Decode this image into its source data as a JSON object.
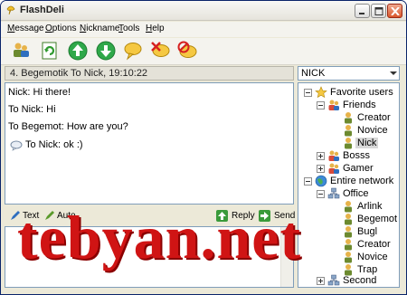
{
  "window": {
    "title": "FlashDeli"
  },
  "menu": [
    "Message",
    "Options",
    "Nickname",
    "Tools",
    "Help"
  ],
  "menu_underline": [
    "M",
    "O",
    "N",
    "T",
    "H"
  ],
  "toolbar_icons": [
    "users-icon",
    "refresh-icon",
    "arrow-up-icon",
    "arrow-down-icon",
    "message-icon",
    "delete-message-icon",
    "ignore-icon"
  ],
  "conversation": {
    "header": "4. Begemotik To  Nick, 19:10:22"
  },
  "nick_select": {
    "value": "NICK"
  },
  "chat": [
    "Nick: Hi there!",
    "To  Nick: Hi",
    "To  Begemot: How are you?",
    "To  Nick:  ok :)"
  ],
  "input_toolbar": {
    "text_label": "Text",
    "auto_label": "Auto",
    "reply_label": "Reply",
    "send_label": "Send"
  },
  "tree": {
    "favorite": "Favorite users",
    "friends": "Friends",
    "friends_children": [
      "Creator",
      "Novice",
      "Nick"
    ],
    "bosss": "Bosss",
    "gamer": "Gamer",
    "network": "Entire network",
    "office": "Office",
    "office_children": [
      "Arlink",
      "Begemot",
      "Bugl",
      "Creator",
      "Novice",
      "Trap"
    ],
    "second": "Second"
  },
  "watermark": "tebyan.net",
  "colors": {
    "watermark": "#d01414",
    "selection": "#d8d8d8"
  }
}
